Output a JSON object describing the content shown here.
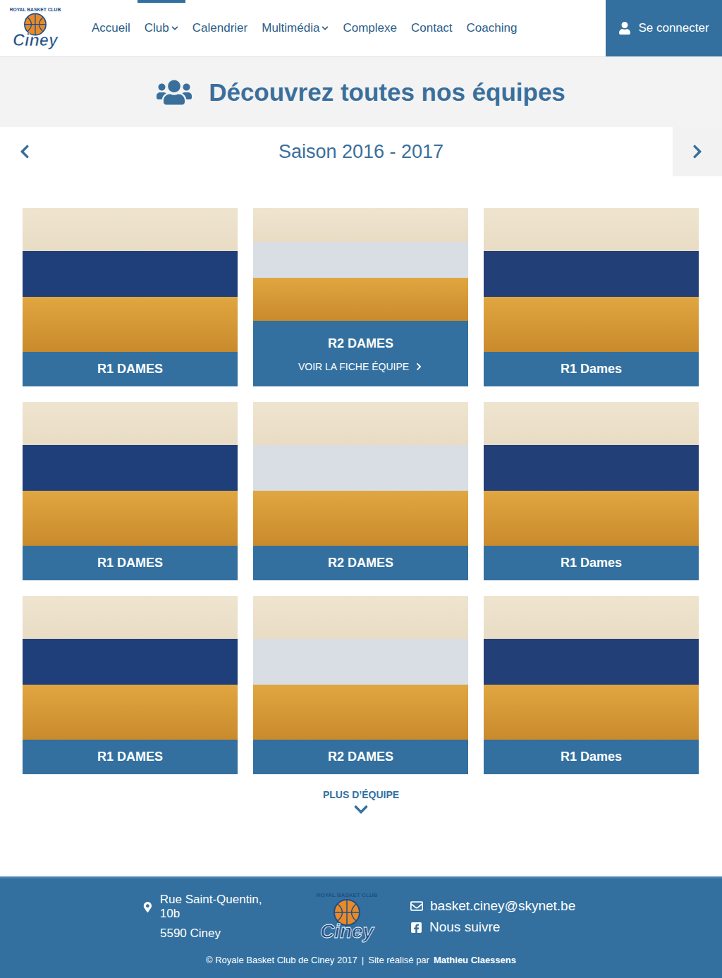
{
  "logo": {
    "name": "Ciney",
    "tagline": "ROYAL BASKET CLUB"
  },
  "nav": [
    {
      "label": "Accueil",
      "selected": false,
      "dropdown": false
    },
    {
      "label": "Club",
      "selected": true,
      "dropdown": true
    },
    {
      "label": "Calendrier",
      "selected": false,
      "dropdown": false
    },
    {
      "label": "Multimédia",
      "selected": false,
      "dropdown": true
    },
    {
      "label": "Complexe",
      "selected": false,
      "dropdown": false
    },
    {
      "label": "Contact",
      "selected": false,
      "dropdown": false
    },
    {
      "label": "Coaching",
      "selected": false,
      "dropdown": false
    }
  ],
  "login": {
    "label": "Se connecter"
  },
  "title": "Découvrez toutes nos équipes",
  "season": {
    "label": "Saison 2016 - 2017"
  },
  "teams": [
    {
      "name": "R1 DAMES",
      "hovered": false,
      "color": "#1e3f7a"
    },
    {
      "name": "R2 DAMES",
      "hovered": true,
      "color": "#d9dde4"
    },
    {
      "name": "R1 Dames",
      "hovered": false,
      "color": "#223f78"
    },
    {
      "name": "R1 DAMES",
      "hovered": false,
      "color": "#1e3f7a"
    },
    {
      "name": "R2 DAMES",
      "hovered": false,
      "color": "#d9dde4"
    },
    {
      "name": "R1 Dames",
      "hovered": false,
      "color": "#223f78"
    },
    {
      "name": "R1 DAMES",
      "hovered": false,
      "color": "#1e3f7a"
    },
    {
      "name": "R2 DAMES",
      "hovered": false,
      "color": "#d9dde4"
    },
    {
      "name": "R1 Dames",
      "hovered": false,
      "color": "#223f78"
    }
  ],
  "team_link": "VOIR LA FICHE ÉQUIPE",
  "more": "PLUS D’ÉQUIPE",
  "footer": {
    "address": [
      "Rue Saint-Quentin, 10b",
      "5590 Ciney"
    ],
    "email": "basket.ciney@skynet.be",
    "follow": "Nous suivre",
    "copyright": "© Royale Basket Club de Ciney 2017",
    "separator": "|",
    "credit": "Site réalisé par",
    "author": "Mathieu Claessens"
  }
}
